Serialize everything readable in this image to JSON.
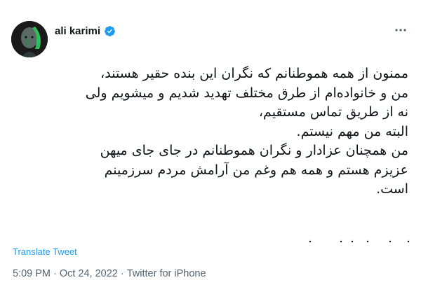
{
  "tweet": {
    "author_name": "ali karimi",
    "lines": [
      "ممنون از همه هموطنانم که نگران این بنده حقیر هستند،",
      "من و خانواده‌ام از طرق مختلف تهدید شدیم و میشویم ولی",
      "نه از طریق تماس مستقیم،",
      "البته من مهم نیستم.",
      "من همچنان عزادار و نگران هموطنانم در جای جای میهن",
      "عزیزم هستم و همه هم وغم من آرامش مردم سرزمینم",
      "است."
    ],
    "translate_label": "Translate Tweet",
    "time": "5:09 PM",
    "separator": "·",
    "date": "Oct 24, 2022",
    "source": "Twitter for iPhone"
  },
  "colors": {
    "accent": "#1d9bf0",
    "meta_text": "#536471",
    "main_text": "#0f1419"
  },
  "icons": {
    "verified": "verified-badge-icon",
    "more": "more-options-icon"
  }
}
